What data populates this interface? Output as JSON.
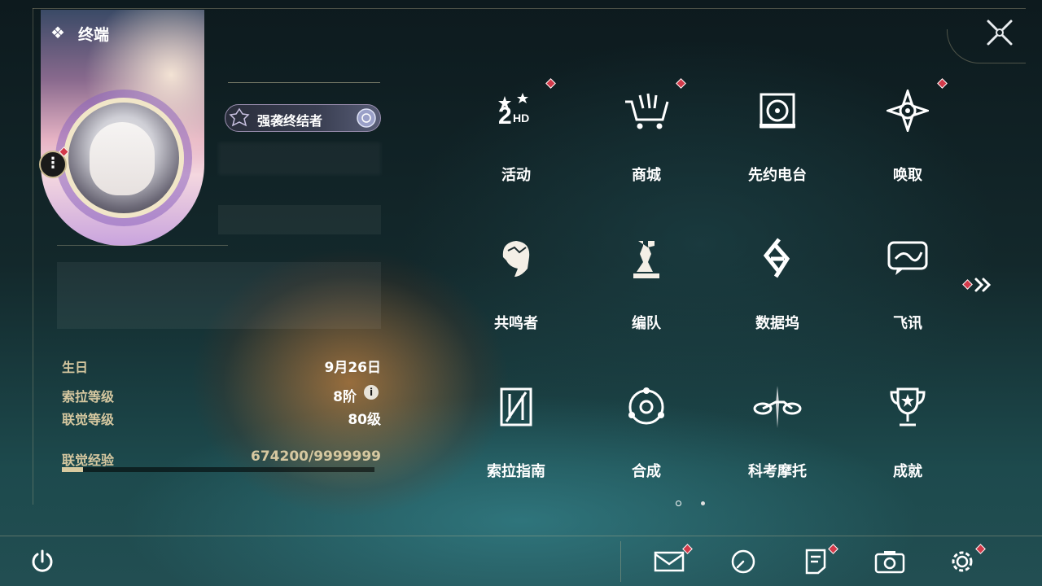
{
  "terminal": {
    "title": "终端",
    "icon": "diamond-cluster-icon"
  },
  "profile": {
    "player_title": "强袭终结者",
    "birthday_label": "生日",
    "birthday_value": "9月26日",
    "sola_level_label": "索拉等级",
    "sola_level_value": "8阶",
    "union_level_label": "联觉等级",
    "union_level_value": "80级",
    "union_exp_label": "联觉经验",
    "union_exp_value": "674200/9999999",
    "union_exp_progress": 0.0674
  },
  "menu": [
    {
      "label": "活动",
      "icon": "event-2hd-icon",
      "badge": true
    },
    {
      "label": "商城",
      "icon": "shop-cart-icon",
      "badge": true
    },
    {
      "label": "先约电台",
      "icon": "radio-record-icon",
      "badge": false
    },
    {
      "label": "唤取",
      "icon": "convene-compass-icon",
      "badge": true
    },
    {
      "label": "共鸣者",
      "icon": "resonator-head-icon",
      "badge": false
    },
    {
      "label": "编队",
      "icon": "team-chess-icon",
      "badge": false
    },
    {
      "label": "数据坞",
      "icon": "data-bank-icon",
      "badge": false
    },
    {
      "label": "飞讯",
      "icon": "message-chat-icon",
      "badge": false
    },
    {
      "label": "索拉指南",
      "icon": "guide-book-icon",
      "badge": false
    },
    {
      "label": "合成",
      "icon": "synthesis-orbit-icon",
      "badge": false
    },
    {
      "label": "科考摩托",
      "icon": "motorbike-icon",
      "badge": false
    },
    {
      "label": "成就",
      "icon": "trophy-icon",
      "badge": false
    }
  ],
  "colors": {
    "accent_gold": "#d8caa0",
    "badge_red": "#d33a4a"
  }
}
